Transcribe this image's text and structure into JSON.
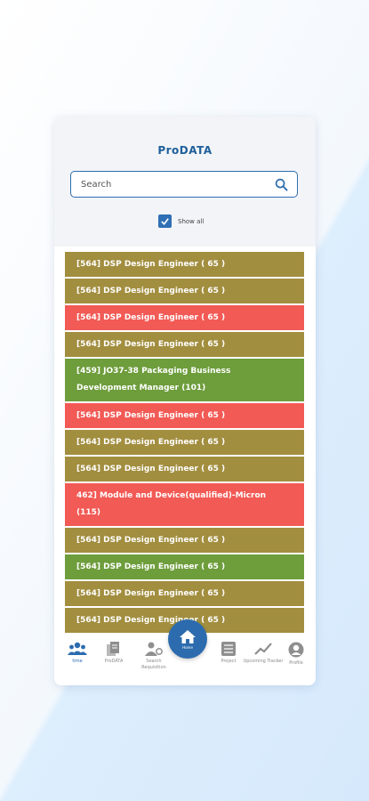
{
  "app": {
    "title": "ProDATA"
  },
  "search": {
    "placeholder": "Search"
  },
  "filter": {
    "show_all_label": "Show all",
    "checked": true
  },
  "colors": {
    "olive": "#a28e3f",
    "red": "#f25a55",
    "green": "#6e9d3c",
    "primary": "#2c6cae"
  },
  "list": [
    {
      "label": "[564] DSP Design Engineer ( 65 )",
      "color": "olive"
    },
    {
      "label": "[564] DSP Design Engineer ( 65 )",
      "color": "olive"
    },
    {
      "label": "[564] DSP Design Engineer ( 65 )",
      "color": "red"
    },
    {
      "label": "[564] DSP Design Engineer ( 65 )",
      "color": "olive"
    },
    {
      "label": "[459] JO37-38 Packaging Business Development Manager (101)",
      "color": "green"
    },
    {
      "label": "[564] DSP Design Engineer ( 65 )",
      "color": "red"
    },
    {
      "label": "[564] DSP Design Engineer ( 65 )",
      "color": "olive"
    },
    {
      "label": "[564] DSP Design Engineer ( 65 )",
      "color": "olive"
    },
    {
      "label": "462] Module and Device(qualified)-Micron (115)",
      "color": "red"
    },
    {
      "label": "[564] DSP Design Engineer ( 65 )",
      "color": "olive"
    },
    {
      "label": "[564] DSP Design Engineer ( 65 )",
      "color": "green"
    },
    {
      "label": "[564] DSP Design Engineer ( 65 )",
      "color": "olive"
    },
    {
      "label": "[564] DSP Design Engineer ( 65 )",
      "color": "olive"
    },
    {
      "label": "",
      "color": "olive"
    }
  ],
  "nav": {
    "time": "time",
    "products": "ProDATA",
    "search_requisition": "Search Requisition",
    "home": "Home",
    "project": "Project",
    "upcoming_tracker": "Upcoming Tracker",
    "profile": "Profile"
  }
}
